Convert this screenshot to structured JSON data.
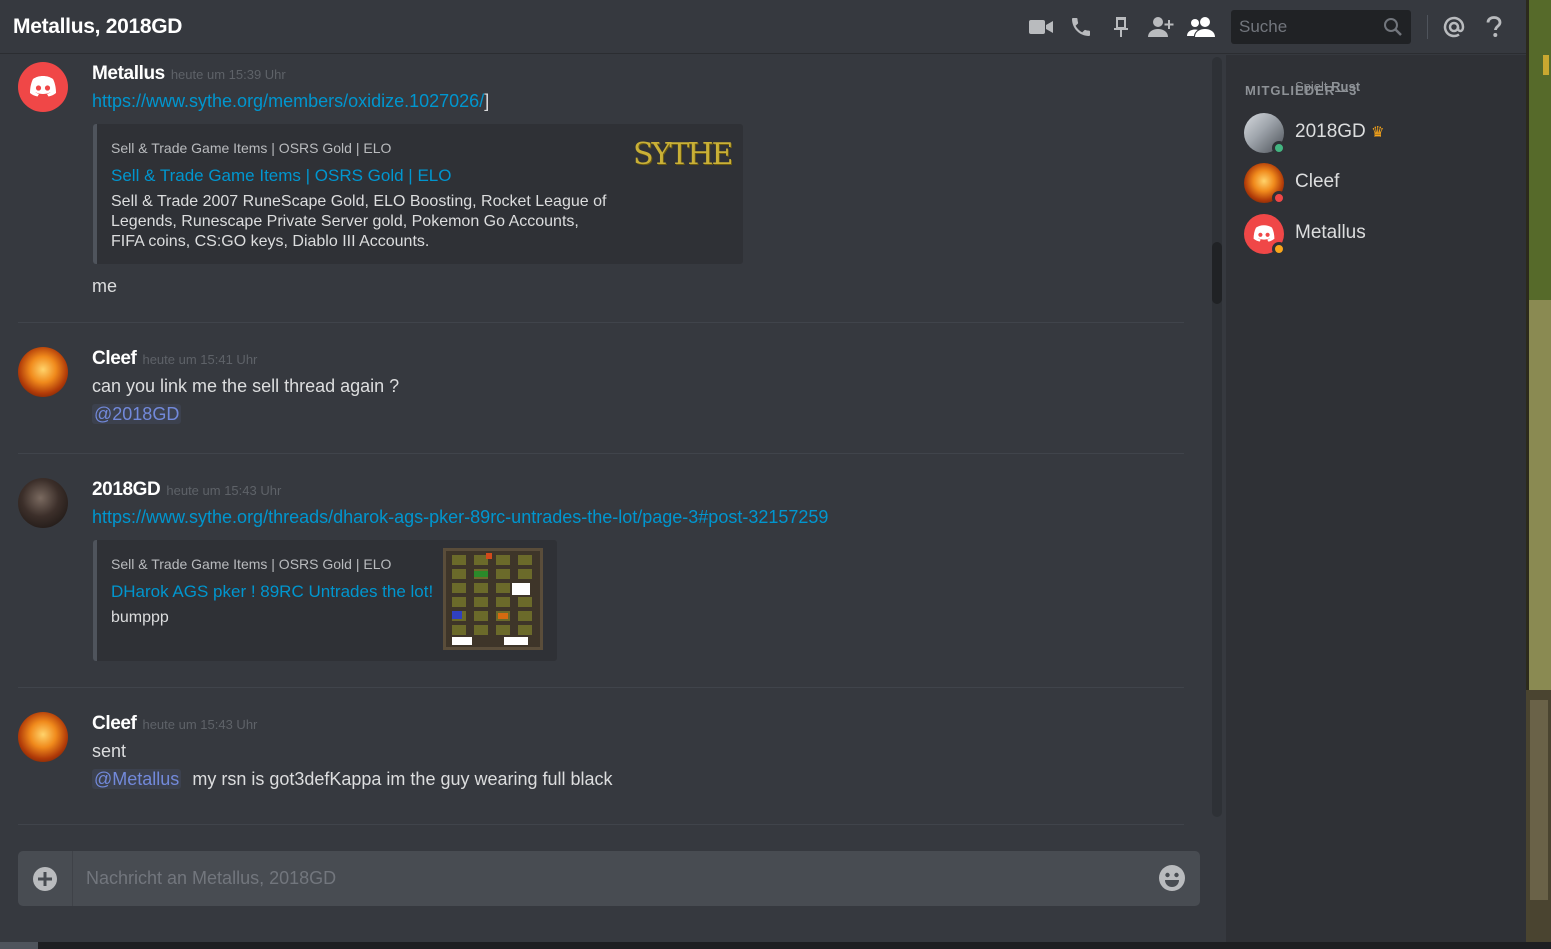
{
  "header": {
    "title": "Metallus, 2018GD",
    "search_placeholder": "Suche"
  },
  "messages": [
    {
      "username": "Metallus",
      "timestamp": "heute um 15:39 Uhr",
      "link": "https://www.sythe.org/members/oxidize.1027026/",
      "link_suffix": "]",
      "embed": {
        "provider": "Sell & Trade Game Items | OSRS Gold | ELO",
        "title": "Sell & Trade Game Items | OSRS Gold | ELO",
        "desc1": "Sell & Trade 2007 RuneScape Gold, ELO Boosting, Rocket League of",
        "desc2": "Legends, Runescape Private Server gold, Pokemon Go Accounts,",
        "desc3": "FIFA coins, CS:GO keys, Diablo III Accounts.",
        "logo_text": "SYTHE"
      },
      "text": "me"
    },
    {
      "username": "Cleef",
      "timestamp": "heute um 15:41 Uhr",
      "text": "can you link me the sell thread again ?",
      "mention": "@2018GD"
    },
    {
      "username": "2018GD",
      "timestamp": "heute um 15:43 Uhr",
      "link": "https://www.sythe.org/threads/dharok-ags-pker-89rc-untrades-the-lot/page-3#post-32157259",
      "embed": {
        "provider": "Sell & Trade Game Items | OSRS Gold | ELO",
        "title": "DHarok AGS pker ! 89RC Untrades the lot!",
        "desc": "bumppp"
      }
    },
    {
      "username": "Cleef",
      "timestamp": "heute um 15:43 Uhr",
      "text": "sent",
      "mention": "@Metallus",
      "text2": "my rsn is  got3defKappa  im the guy wearing full black"
    }
  ],
  "members": {
    "header": "MITGLIEDER—3",
    "list": [
      {
        "name": "2018GD",
        "activity_prefix": "Spielt",
        "activity": "Rust",
        "status_color": "#43b581",
        "owner_crown": "♛"
      },
      {
        "name": "Cleef",
        "status_color": "#f04747"
      },
      {
        "name": "Metallus",
        "status_color": "#faa61a"
      }
    ]
  },
  "composer": {
    "placeholder": "Nachricht an Metallus, 2018GD"
  },
  "colors": {
    "link": "#0096cf",
    "mention": "#7289da",
    "discord_red": "#f04747"
  },
  "icons": [
    "video-icon",
    "phone-icon",
    "pin-icon",
    "add-user-icon",
    "members-icon",
    "search-icon",
    "mention-icon",
    "help-icon",
    "plus-icon",
    "emoji-icon"
  ]
}
